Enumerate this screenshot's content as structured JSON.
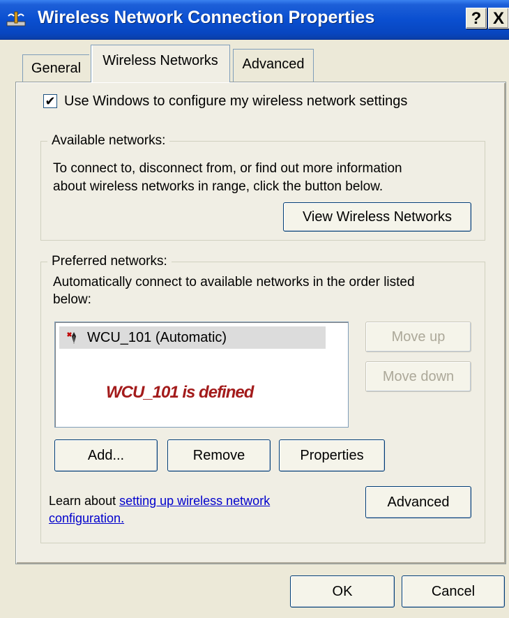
{
  "window": {
    "title": "Wireless Network Connection Properties",
    "help_label": "?",
    "close_label": "X"
  },
  "tabs": [
    {
      "label": "General"
    },
    {
      "label": "Wireless Networks",
      "selected": true
    },
    {
      "label": "Advanced"
    }
  ],
  "use_windows_checkbox": {
    "label": "Use Windows to configure my wireless network settings",
    "checked": true,
    "mark": "✔"
  },
  "available_networks": {
    "legend": "Available networks:",
    "description_line1": "To connect to, disconnect from, or find out more information",
    "description_line2": "about wireless networks in range, click the button below.",
    "view_button": "View Wireless Networks"
  },
  "preferred_networks": {
    "legend": "Preferred networks:",
    "description_line1": "Automatically connect to available networks in the order listed",
    "description_line2": "below:",
    "items": [
      {
        "label": "WCU_101 (Automatic)",
        "icon": "wireless-network-icon"
      }
    ],
    "annotation": "WCU_101 is defined",
    "move_up_button": "Move up",
    "move_down_button": "Move down",
    "add_button": "Add...",
    "remove_button": "Remove",
    "properties_button": "Properties",
    "learn_text": "Learn about ",
    "learn_link_line1": "setting up wireless network",
    "learn_link_line2": "configuration.",
    "advanced_button": "Advanced"
  },
  "footer": {
    "ok_button": "OK",
    "cancel_button": "Cancel"
  },
  "colors": {
    "title_bar": "#0a4fd0",
    "dialog_bg": "#ece9d8",
    "link": "#0000cc",
    "annotation": "#a31b1b"
  }
}
